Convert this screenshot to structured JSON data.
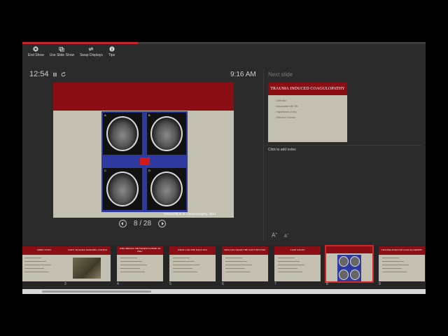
{
  "progress": {
    "fraction": 0.286
  },
  "toolbar": {
    "items": [
      {
        "label": "End Show",
        "icon": "end-show-icon"
      },
      {
        "label": "Use Slide Show",
        "icon": "slide-show-icon"
      },
      {
        "label": "Swap Displays",
        "icon": "swap-displays-icon"
      },
      {
        "label": "Tips",
        "icon": "tips-icon"
      }
    ]
  },
  "timer": {
    "elapsed": "12:54"
  },
  "clock": {
    "time": "9:16 AM"
  },
  "current_slide": {
    "labels": [
      "A",
      "B",
      "C",
      "D"
    ],
    "caption": "Gennarelli et al J Neurosurgery, 2012"
  },
  "navigation": {
    "counter": "8 / 28"
  },
  "next_slide": {
    "heading": "Next slide",
    "title": "TRAUMA INDUCED COAGULOPATHY",
    "bullets": [
      "Definition",
      "Association with TBI",
      "Hypotheses of why",
      "Effects in Trauma"
    ]
  },
  "notes": {
    "placeholder": "Click to add notes"
  },
  "font_controls": {
    "increase": "A",
    "decrease": "A"
  },
  "thumbnails": [
    {
      "title": "OBJECTIVES",
      "number": "",
      "kind": "text"
    },
    {
      "title": "NAVY TRAUMA TRAINING CENTER",
      "number": "3",
      "kind": "photo"
    },
    {
      "title": "WHO BRINGS TBI PATIENTS HERE SO BIG?",
      "number": "4",
      "kind": "text"
    },
    {
      "title": "WHAT CAN THE NAVY DO?",
      "number": "5",
      "kind": "text"
    },
    {
      "title": "HOW DO I MAKE THE NAVY BETTER?",
      "number": "6",
      "kind": "text"
    },
    {
      "title": "CASE STUDY",
      "number": "7",
      "kind": "text"
    },
    {
      "title": "",
      "number": "8",
      "kind": "figure"
    },
    {
      "title": "TRAUMA INDUCED COAGULOPATHY",
      "number": "9",
      "kind": "text"
    }
  ],
  "colors": {
    "accent": "#c0282d",
    "slide_band": "#8a0e14",
    "slide_bg": "#c3c0b2",
    "figure_bg": "#2e3aa0"
  }
}
